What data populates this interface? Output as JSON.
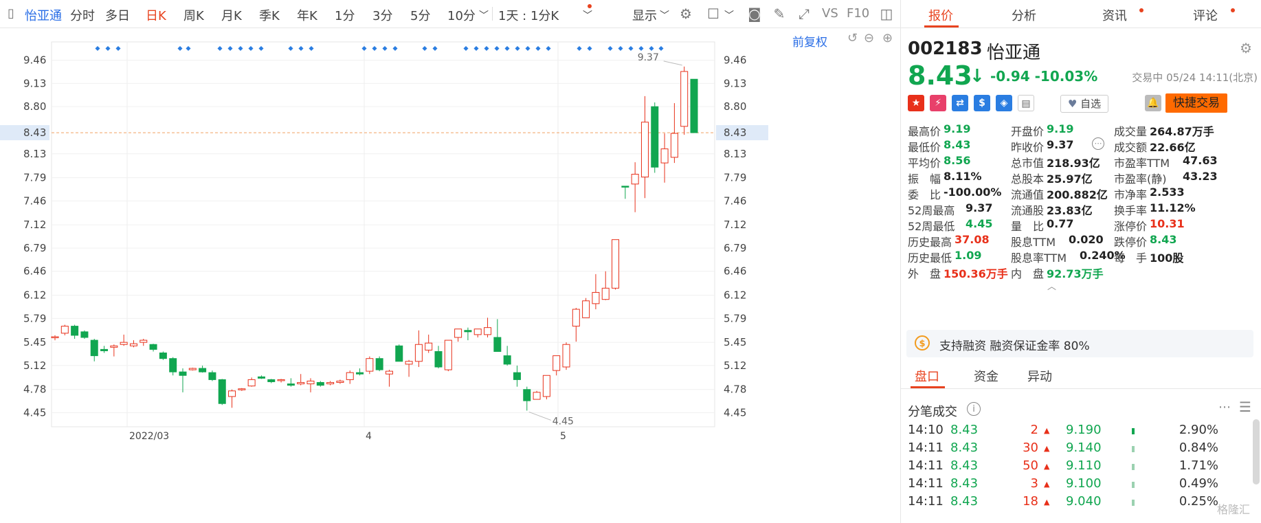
{
  "toolbar": {
    "stock_name": "怡亚通",
    "periods": [
      "分时",
      "多日",
      "日K",
      "周K",
      "月K",
      "季K",
      "年K",
      "1分",
      "3分",
      "5分",
      "10分"
    ],
    "active_period": "日K",
    "interval_select": "1天 : 1分K",
    "display_label": "显示",
    "fq_label": "前复权",
    "vs_label": "VS",
    "f10_label": "F10"
  },
  "colors": {
    "up": "#e8301a",
    "down": "#11a650",
    "accent": "#e8431f",
    "brand_blue": "#2a6ee6",
    "price_line": "#f0a060"
  },
  "chart_data": {
    "type": "candlestick",
    "ylim": [
      4.25,
      9.72
    ],
    "y_ticks": [
      "9.46",
      "9.13",
      "8.80",
      "8.43",
      "8.13",
      "7.79",
      "7.46",
      "7.12",
      "6.79",
      "6.46",
      "6.12",
      "5.79",
      "5.45",
      "5.12",
      "4.78",
      "4.45"
    ],
    "current_price": "8.43",
    "x_labels": [
      "2022/03",
      "4",
      "5"
    ],
    "high_marker": "9.37",
    "low_marker": "4.45",
    "candles": [
      [
        5.52,
        5.55,
        5.48,
        5.53
      ],
      [
        5.58,
        5.7,
        5.55,
        5.68
      ],
      [
        5.68,
        5.7,
        5.5,
        5.55
      ],
      [
        5.6,
        5.62,
        5.5,
        5.52
      ],
      [
        5.48,
        5.5,
        5.18,
        5.26
      ],
      [
        5.35,
        5.4,
        5.3,
        5.33
      ],
      [
        5.38,
        5.42,
        5.25,
        5.4
      ],
      [
        5.42,
        5.56,
        5.4,
        5.45
      ],
      [
        5.4,
        5.48,
        5.38,
        5.43
      ],
      [
        5.45,
        5.5,
        5.4,
        5.48
      ],
      [
        5.42,
        5.43,
        5.32,
        5.35
      ],
      [
        5.3,
        5.32,
        5.2,
        5.22
      ],
      [
        5.22,
        5.24,
        4.98,
        5.03
      ],
      [
        5.03,
        5.08,
        4.74,
        4.98
      ],
      [
        5.06,
        5.09,
        5.05,
        5.08
      ],
      [
        5.08,
        5.12,
        5.02,
        5.03
      ],
      [
        5.02,
        5.05,
        4.9,
        4.92
      ],
      [
        4.92,
        4.93,
        4.56,
        4.58
      ],
      [
        4.68,
        4.78,
        4.52,
        4.76
      ],
      [
        4.78,
        4.8,
        4.76,
        4.79
      ],
      [
        4.83,
        4.95,
        4.82,
        4.92
      ],
      [
        4.96,
        4.98,
        4.93,
        4.94
      ],
      [
        4.92,
        4.93,
        4.87,
        4.89
      ],
      [
        4.91,
        4.93,
        4.88,
        4.92
      ],
      [
        4.86,
        4.94,
        4.82,
        4.84
      ],
      [
        4.86,
        5.0,
        4.84,
        4.88
      ],
      [
        4.86,
        4.94,
        4.74,
        4.9
      ],
      [
        4.88,
        4.9,
        4.82,
        4.84
      ],
      [
        4.86,
        4.9,
        4.84,
        4.88
      ],
      [
        4.88,
        4.92,
        4.86,
        4.9
      ],
      [
        4.92,
        5.05,
        4.86,
        5.02
      ],
      [
        5.02,
        5.08,
        4.98,
        5.0
      ],
      [
        5.04,
        5.25,
        5.0,
        5.22
      ],
      [
        5.22,
        5.25,
        5.04,
        5.06
      ],
      [
        5.0,
        5.06,
        4.82,
        5.04
      ],
      [
        5.4,
        5.42,
        5.18,
        5.18
      ],
      [
        5.14,
        5.2,
        4.96,
        5.18
      ],
      [
        5.18,
        5.62,
        5.1,
        5.42
      ],
      [
        5.34,
        5.56,
        5.3,
        5.44
      ],
      [
        5.32,
        5.4,
        5.08,
        5.1
      ],
      [
        5.06,
        5.48,
        5.04,
        5.48
      ],
      [
        5.52,
        5.64,
        5.46,
        5.64
      ],
      [
        5.62,
        5.66,
        5.48,
        5.6
      ],
      [
        5.56,
        5.62,
        5.52,
        5.64
      ],
      [
        5.56,
        5.8,
        5.52,
        5.66
      ],
      [
        5.52,
        5.78,
        5.32,
        5.32
      ],
      [
        5.26,
        5.4,
        5.12,
        5.14
      ],
      [
        5.02,
        5.12,
        4.82,
        4.92
      ],
      [
        4.78,
        4.82,
        4.48,
        4.62
      ],
      [
        4.64,
        4.76,
        4.64,
        4.74
      ],
      [
        4.68,
        4.98,
        4.64,
        4.98
      ],
      [
        5.05,
        5.26,
        4.98,
        5.26
      ],
      [
        5.1,
        5.45,
        5.06,
        5.42
      ],
      [
        5.68,
        5.94,
        5.46,
        5.92
      ],
      [
        5.8,
        6.08,
        5.82,
        6.04
      ],
      [
        6.0,
        6.42,
        5.92,
        6.16
      ],
      [
        6.06,
        6.46,
        6.05,
        6.22
      ],
      [
        6.22,
        6.91,
        6.2,
        6.91
      ],
      [
        7.67,
        7.67,
        7.49,
        7.67
      ],
      [
        7.7,
        8.01,
        7.3,
        7.84
      ],
      [
        7.8,
        8.95,
        7.5,
        8.58
      ],
      [
        8.8,
        8.86,
        7.86,
        7.94
      ],
      [
        8.0,
        8.42,
        7.72,
        8.2
      ],
      [
        8.08,
        8.85,
        8.0,
        8.42
      ],
      [
        8.52,
        9.37,
        8.4,
        9.3
      ],
      [
        9.19,
        9.19,
        8.43,
        8.43
      ]
    ]
  },
  "right": {
    "tabs": [
      "报价",
      "分析",
      "资讯",
      "评论"
    ],
    "code": "002183",
    "name": "怡亚通",
    "price": "8.43",
    "change": "-0.94",
    "change_pct": "-10.03%",
    "status": "交易中 05/24 14:11(北京)",
    "zixuan": "自选",
    "fast_trade": "快捷交易",
    "stats": [
      [
        [
          "最高价",
          "9.19",
          "g"
        ],
        [
          "开盘价",
          "9.19",
          "g"
        ],
        [
          "成交量",
          "264.87万手",
          "k"
        ]
      ],
      [
        [
          "最低价",
          "8.43",
          "g"
        ],
        [
          "昨收价",
          "9.37",
          "k"
        ],
        [
          "成交额",
          "22.66亿",
          "k"
        ]
      ],
      [
        [
          "平均价",
          "8.56",
          "g"
        ],
        [
          "总市值",
          "218.93亿",
          "k"
        ],
        [
          "市盈率TTM",
          "47.63",
          "k"
        ]
      ],
      [
        [
          "振　幅",
          "8.11%",
          "k"
        ],
        [
          "总股本",
          "25.97亿",
          "k"
        ],
        [
          "市盈率(静)",
          "43.23",
          "k"
        ]
      ],
      [
        [
          "委　比",
          "-100.00%",
          "k"
        ],
        [
          "流通值",
          "200.882亿",
          "k"
        ],
        [
          "市净率",
          "2.533",
          "k"
        ]
      ],
      [
        [
          "52周最高",
          "9.37",
          "k"
        ],
        [
          "流通股",
          "23.83亿",
          "k"
        ],
        [
          "换手率",
          "11.12%",
          "k"
        ]
      ],
      [
        [
          "52周最低",
          "4.45",
          "g"
        ],
        [
          "量　比",
          "0.77",
          "k"
        ],
        [
          "涨停价",
          "10.31",
          "r"
        ]
      ],
      [
        [
          "历史最高",
          "37.08",
          "r"
        ],
        [
          "股息TTM",
          "0.020",
          "k"
        ],
        [
          "跌停价",
          "8.43",
          "g"
        ]
      ],
      [
        [
          "历史最低",
          "1.09",
          "g"
        ],
        [
          "股息率TTM",
          "0.240%",
          "k"
        ],
        [
          "每　手",
          "100股",
          "k"
        ]
      ],
      [
        [
          "外　盘",
          "150.36万手",
          "r"
        ],
        [
          "内　盘",
          "92.73万手",
          "g"
        ],
        [
          "",
          "",
          " k"
        ]
      ]
    ],
    "rz_text": "支持融资 融资保证金率 80%",
    "tabs2": [
      "盘口",
      "资金",
      "异动"
    ],
    "fb_title": "分笔成交",
    "trades": [
      [
        "14:10",
        "8.43",
        "2",
        "9.190",
        "2.90%"
      ],
      [
        "14:11",
        "8.43",
        "30",
        "9.140",
        "0.84%"
      ],
      [
        "14:11",
        "8.43",
        "50",
        "9.110",
        "1.71%"
      ],
      [
        "14:11",
        "8.43",
        "3",
        "9.100",
        "0.49%"
      ],
      [
        "14:11",
        "8.43",
        "18",
        "9.040",
        "0.25%"
      ]
    ],
    "watermark": "格隆汇"
  }
}
